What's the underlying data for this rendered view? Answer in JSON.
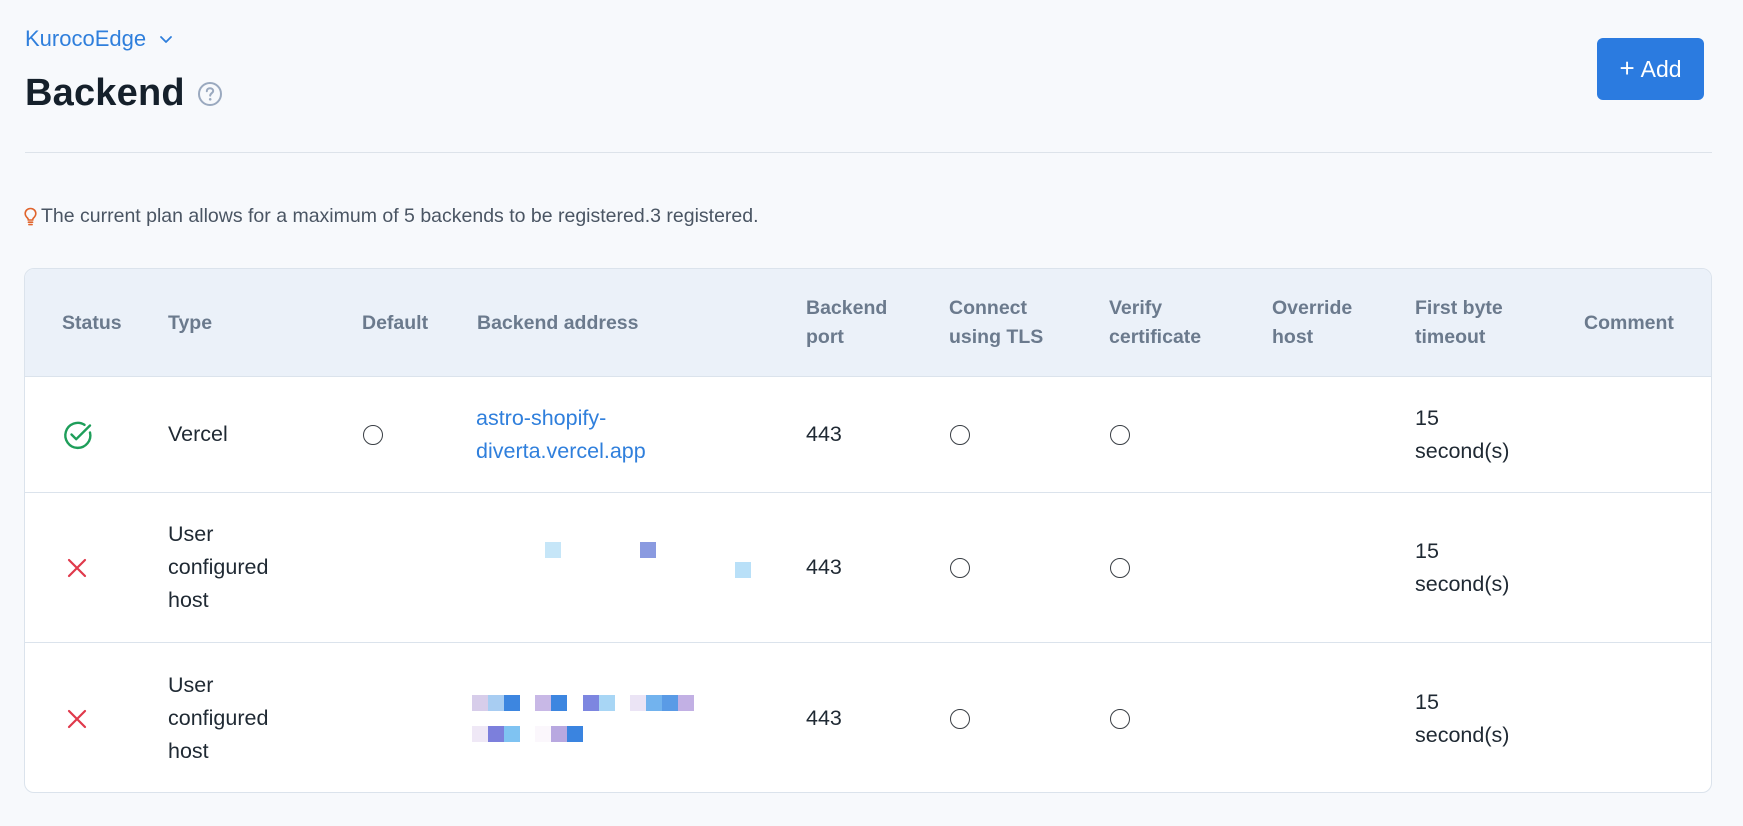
{
  "header": {
    "project_name": "KurocoEdge",
    "title": "Backend",
    "add_label": "Add"
  },
  "notice": {
    "text": "The current plan allows for a maximum of 5 backends to be registered.3 registered."
  },
  "table": {
    "columns": [
      "Status",
      "Type",
      "Default",
      "Backend address",
      "Backend port",
      "Connect using TLS",
      "Verify certificate",
      "Override host",
      "First byte timeout",
      "Comment"
    ],
    "rows": [
      {
        "status": "ok",
        "status_icon": "check-circle-icon",
        "type": "Vercel",
        "backend_address": "astro-shopify-diverta.vercel.app",
        "backend_port": "443",
        "override_host": "",
        "first_byte_timeout": "15 second(s)",
        "comment": ""
      },
      {
        "status": "error",
        "status_icon": "x-icon",
        "type": "User configured host",
        "backend_address": "",
        "backend_port": "443",
        "override_host": "",
        "first_byte_timeout": "15 second(s)",
        "comment": ""
      },
      {
        "status": "error",
        "status_icon": "x-icon",
        "type": "User configured host",
        "backend_address": "",
        "backend_port": "443",
        "override_host": "",
        "first_byte_timeout": "15 second(s)",
        "comment": ""
      }
    ]
  },
  "colors": {
    "accent": "#2b7be0",
    "link": "#2f7fdc",
    "success": "#1e9e5a",
    "error": "#e0394b",
    "header_bg": "#ebf1f9"
  }
}
